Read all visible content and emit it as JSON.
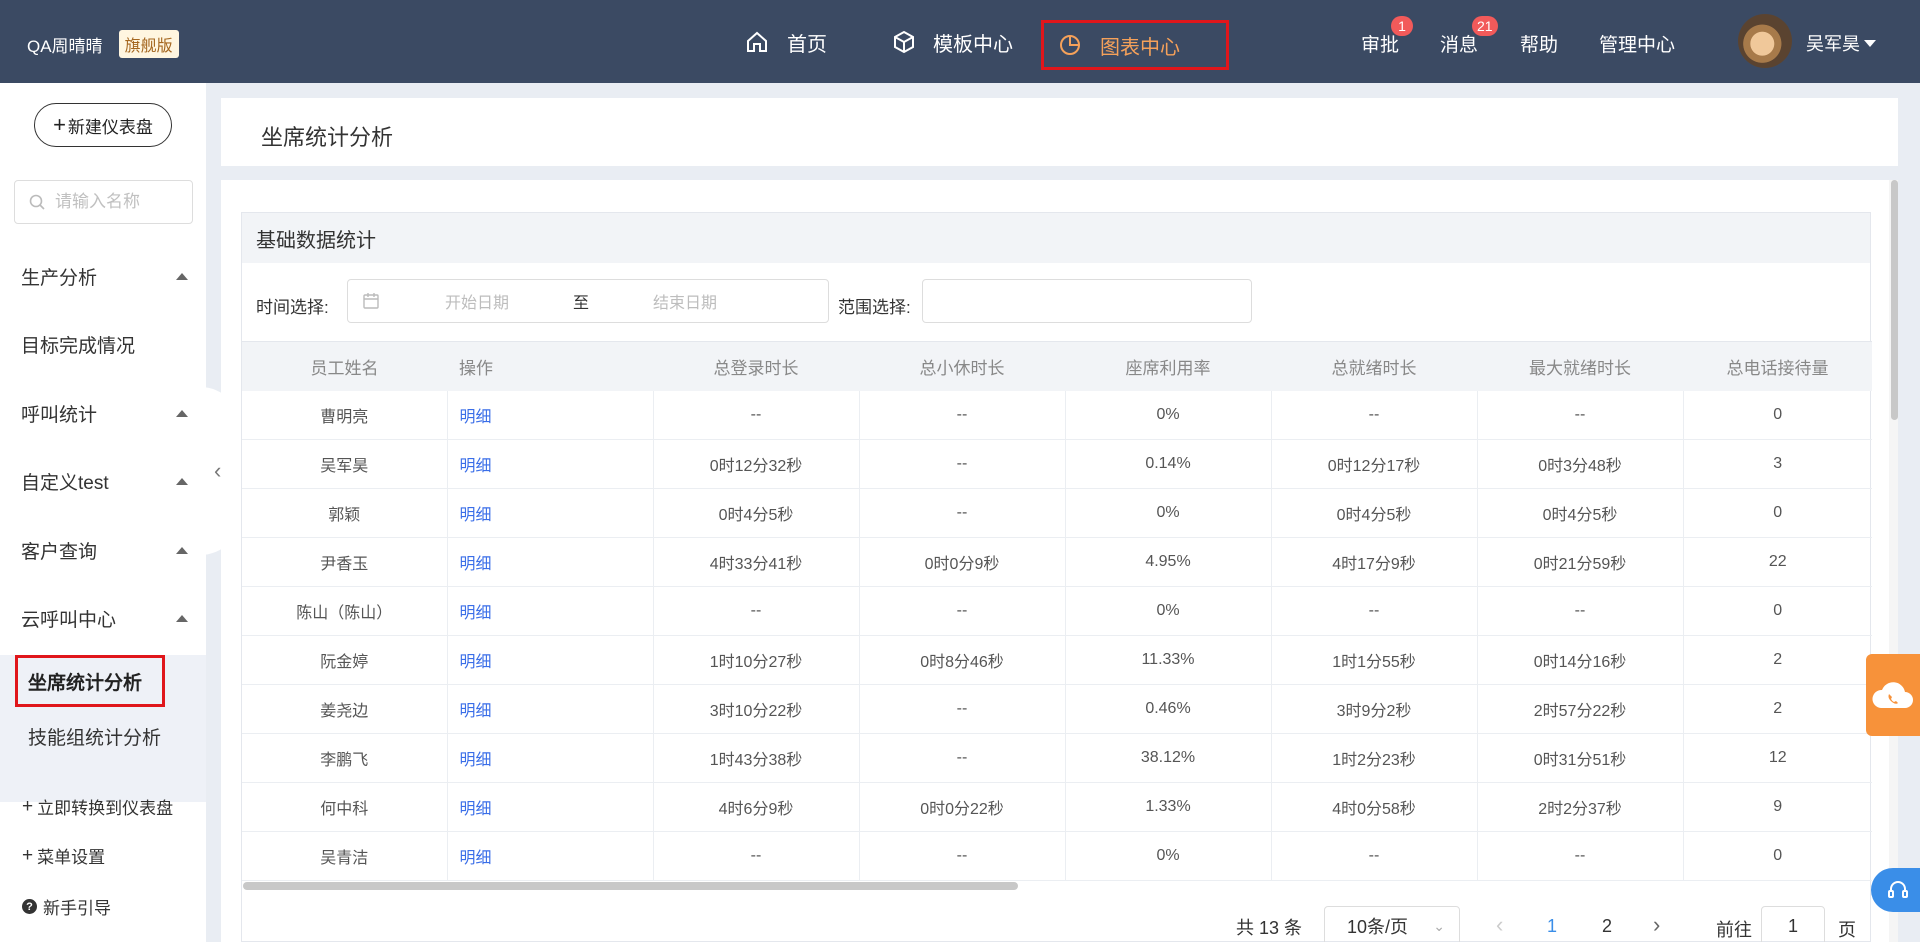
{
  "brand": {
    "name": "QA周晴晴",
    "edition": "旗舰版"
  },
  "nav": {
    "home": "首页",
    "templates": "模板中心",
    "charts": "图表中心"
  },
  "header_right": {
    "approval": "审批",
    "approval_badge": "1",
    "messages": "消息",
    "messages_badge": "21",
    "help": "帮助",
    "admin": "管理中心",
    "user": "吴军昊"
  },
  "sidebar": {
    "new_dashboard": "新建仪表盘",
    "search_placeholder": "请输入名称",
    "groups": [
      "生产分析",
      "目标完成情况",
      "呼叫统计",
      "自定义test",
      "客户查询",
      "云呼叫中心"
    ],
    "active_item": "坐席统计分析",
    "sub_item": "技能组统计分析",
    "convert": "立即转换到仪表盘",
    "menu_settings": "菜单设置",
    "guide": "新手引导"
  },
  "page": {
    "title": "坐席统计分析"
  },
  "section": {
    "title": "基础数据统计",
    "time_label": "时间选择:",
    "start_placeholder": "开始日期",
    "to": "至",
    "end_placeholder": "结束日期",
    "scope_label": "范围选择:"
  },
  "table": {
    "headers": [
      "员工姓名",
      "操作",
      "总登录时长",
      "总小休时长",
      "座席利用率",
      "总就绪时长",
      "最大就绪时长",
      "总电话接待量"
    ],
    "rows": [
      [
        "曹明亮",
        "明细",
        "--",
        "--",
        "0%",
        "--",
        "--",
        "0"
      ],
      [
        "吴军昊",
        "明细",
        "0时12分32秒",
        "--",
        "0.14%",
        "0时12分17秒",
        "0时3分48秒",
        "3"
      ],
      [
        "郭颖",
        "明细",
        "0时4分5秒",
        "--",
        "0%",
        "0时4分5秒",
        "0时4分5秒",
        "0"
      ],
      [
        "尹香玉",
        "明细",
        "4时33分41秒",
        "0时0分9秒",
        "4.95%",
        "4时17分9秒",
        "0时21分59秒",
        "22"
      ],
      [
        "陈山（陈山）",
        "明细",
        "--",
        "--",
        "0%",
        "--",
        "--",
        "0"
      ],
      [
        "阮金婷",
        "明细",
        "1时10分27秒",
        "0时8分46秒",
        "11.33%",
        "1时1分55秒",
        "0时14分16秒",
        "2"
      ],
      [
        "姜尧边",
        "明细",
        "3时10分22秒",
        "--",
        "0.46%",
        "3时9分2秒",
        "2时57分22秒",
        "2"
      ],
      [
        "李鹏飞",
        "明细",
        "1时43分38秒",
        "--",
        "38.12%",
        "1时2分23秒",
        "0时31分51秒",
        "12"
      ],
      [
        "何中科",
        "明细",
        "4时6分9秒",
        "0时0分22秒",
        "1.33%",
        "4时0分58秒",
        "2时2分37秒",
        "9"
      ],
      [
        "吴青洁",
        "明细",
        "--",
        "--",
        "0%",
        "--",
        "--",
        "0"
      ]
    ]
  },
  "pager": {
    "total": "共 13 条",
    "page_size": "10条/页",
    "page1": "1",
    "page2": "2",
    "goto": "前往",
    "goto_value": "1",
    "page_unit": "页"
  },
  "colors": {
    "topbar": "#3b4a63",
    "accent_orange": "#f5a15a",
    "link_blue": "#3a6ee8",
    "highlight_red": "#e0161b"
  }
}
